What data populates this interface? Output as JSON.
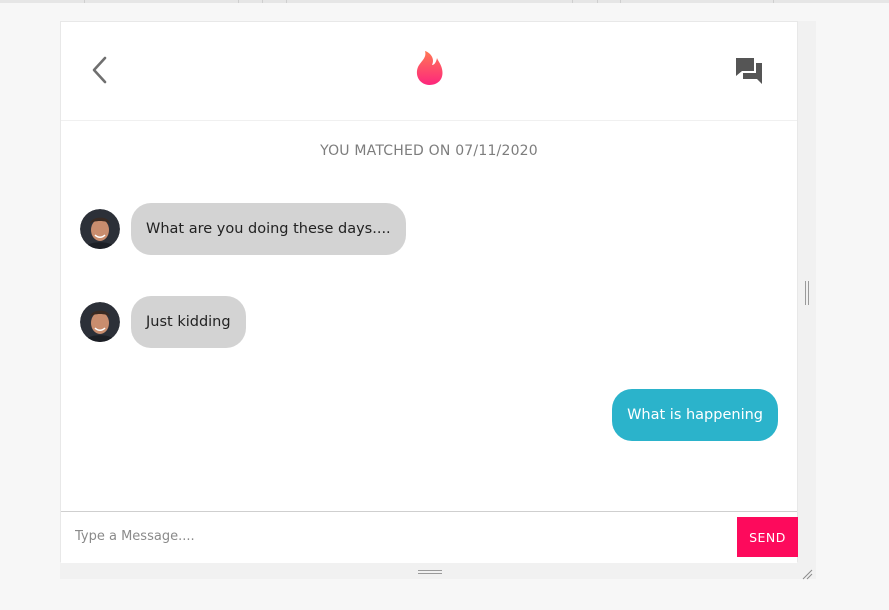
{
  "header": {
    "back_icon": "chevron-left-icon",
    "logo_icon": "flame-icon",
    "chat_icon": "forum-chat-icon"
  },
  "match_banner": "YOU MATCHED ON 07/11/2020",
  "messages": [
    {
      "direction": "incoming",
      "text": "What are you doing these days...."
    },
    {
      "direction": "incoming",
      "text": "Just kidding"
    },
    {
      "direction": "outgoing",
      "text": "What is happening"
    }
  ],
  "composer": {
    "placeholder": "Type a Message....",
    "send_label": "SEND"
  },
  "colors": {
    "brand": "#fd0a5c",
    "outgoing_bubble": "#2bb3cb",
    "incoming_bubble": "#d3d3d3",
    "flame_top": "#ff7854",
    "flame_bottom": "#fd267d"
  }
}
